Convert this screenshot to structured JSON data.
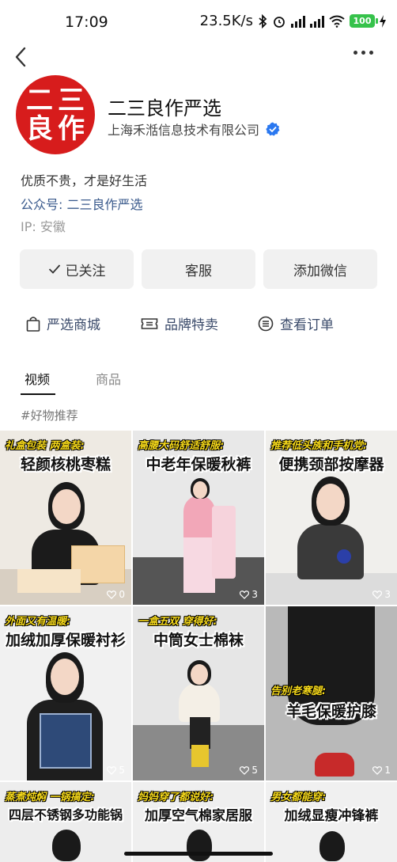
{
  "status": {
    "time": "17:09",
    "speed": "23.5K/s",
    "battery": "100"
  },
  "profile": {
    "avatar_text": [
      "二",
      "三",
      "良",
      "作"
    ],
    "name": "二三良作严选",
    "company": "上海禾湉信息技术有限公司",
    "bio": "优质不贵，才是好生活",
    "gzh": "公众号: 二三良作严选",
    "ip": "IP: 安徽"
  },
  "buttons": {
    "follow": "已关注",
    "service": "客服",
    "wechat": "添加微信"
  },
  "links": {
    "shop": "严选商城",
    "brand": "品牌特卖",
    "orders": "查看订单"
  },
  "tabs": {
    "video": "视频",
    "goods": "商品"
  },
  "tag": "#好物推荐",
  "videos": [
    {
      "cap1": "礼盒包装 两盒装:",
      "cap2": "轻颜核桃枣糕",
      "likes": "0"
    },
    {
      "cap1": "高腰大码舒适舒服:",
      "cap2": "中老年保暖秋裤",
      "likes": "3"
    },
    {
      "cap1": "推荐低头族和手机党:",
      "cap2": "便携颈部按摩器",
      "likes": "3"
    },
    {
      "cap1": "外面又有温暖:",
      "cap2": "加绒加厚保暖衬衫",
      "likes": "5"
    },
    {
      "cap1": "一盒五双 穿得好:",
      "cap2": "中筒女士棉袜",
      "likes": "5"
    },
    {
      "cap1": "告别老寒腿:",
      "cap2": "羊毛保暖护膝",
      "likes": "1"
    },
    {
      "cap1": "蒸煮炖焖 一锅搞定:",
      "cap2": "四层不锈钢多功能锅",
      "likes": ""
    },
    {
      "cap1": "妈妈穿了都说好:",
      "cap2": "加厚空气棉家居服",
      "likes": ""
    },
    {
      "cap1": "男女都能穿:",
      "cap2": "加绒显瘦冲锋裤",
      "likes": ""
    }
  ],
  "colors": {
    "brand_red": "#d71c1c",
    "link_blue": "#3a5a8c",
    "verify_blue": "#2a78f0",
    "caption_yellow": "#f6d91a"
  },
  "icons": [
    "back-icon",
    "more-icon",
    "check-icon",
    "bag-icon",
    "ticket-icon",
    "list-icon",
    "heart-icon",
    "verified-icon"
  ]
}
